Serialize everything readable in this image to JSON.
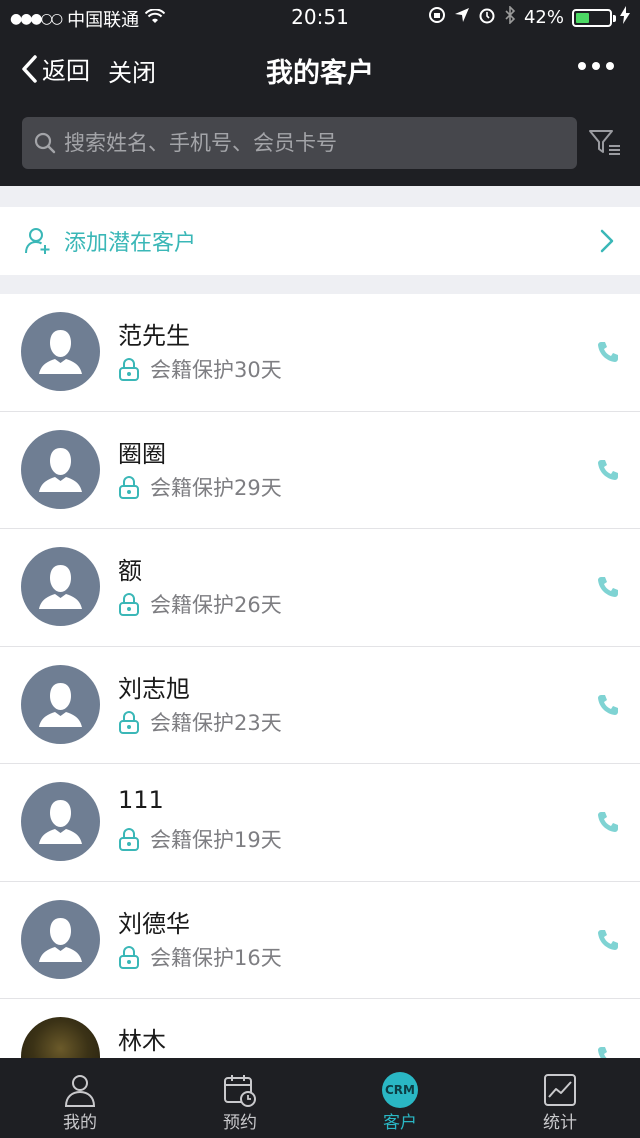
{
  "status_bar": {
    "signal": "●●●○○",
    "carrier": "中国联通",
    "time": "20:51",
    "battery": "42%",
    "battery_level": 0.42
  },
  "nav": {
    "back_label": "返回",
    "close_label": "关闭",
    "title": "我的客户"
  },
  "search": {
    "placeholder": "搜索姓名、手机号、会员卡号"
  },
  "add_customer": {
    "label": "添加潜在客户"
  },
  "customers": [
    {
      "name": "范先生",
      "status": "会籍保护30天"
    },
    {
      "name": "圈圈",
      "status": "会籍保护29天"
    },
    {
      "name": "额",
      "status": "会籍保护26天"
    },
    {
      "name": "刘志旭",
      "status": "会籍保护23天"
    },
    {
      "name": "111",
      "status": "会籍保护19天"
    },
    {
      "name": "刘德华",
      "status": "会籍保护16天"
    },
    {
      "name": "林木",
      "status": ""
    }
  ],
  "tabs": [
    {
      "label": "我的",
      "icon": "person-icon"
    },
    {
      "label": "预约",
      "icon": "calendar-clock-icon"
    },
    {
      "label": "客户",
      "icon": "crm-icon",
      "badge": "CRM"
    },
    {
      "label": "统计",
      "icon": "chart-icon"
    }
  ],
  "colors": {
    "accent": "#3ab7b7",
    "header_bg": "#1e1f23",
    "avatar_bg": "#6f7e93"
  }
}
